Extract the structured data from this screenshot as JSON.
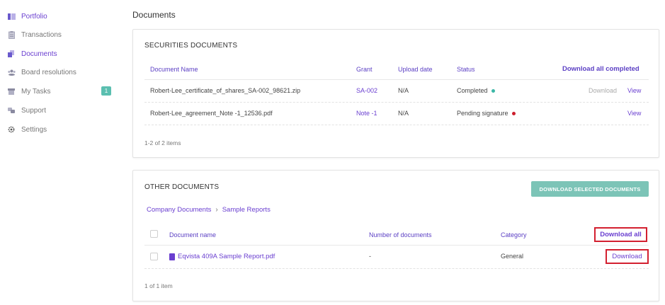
{
  "sidebar": {
    "items": [
      {
        "label": "Portfolio",
        "icon": "portfolio-icon",
        "active": true
      },
      {
        "label": "Transactions",
        "icon": "clipboard-icon",
        "active": false
      },
      {
        "label": "Documents",
        "icon": "documents-icon",
        "active": true
      },
      {
        "label": "Board resolutions",
        "icon": "board-icon",
        "active": false
      },
      {
        "label": "My Tasks",
        "icon": "inbox-icon",
        "active": false,
        "badge": "1"
      },
      {
        "label": "Support",
        "icon": "support-icon",
        "active": false
      },
      {
        "label": "Settings",
        "icon": "gear-icon",
        "active": false
      }
    ]
  },
  "page": {
    "title": "Documents"
  },
  "securities": {
    "title": "SECURITIES DOCUMENTS",
    "columns": {
      "name": "Document Name",
      "grant": "Grant",
      "upload_date": "Upload date",
      "status": "Status",
      "action": "Download all completed"
    },
    "rows": [
      {
        "name": "Robert-Lee_certificate_of_shares_SA-002_98621.zip",
        "grant": "SA-002",
        "upload_date": "N/A",
        "status": "Completed",
        "status_color": "#3cb7a6",
        "download": "Download",
        "view": "View"
      },
      {
        "name": "Robert-Lee_agreement_Note -1_12536.pdf",
        "grant": "Note -1",
        "upload_date": "N/A",
        "status": "Pending signature",
        "status_color": "#cc1e2c",
        "download": "",
        "view": "View"
      }
    ],
    "footer": "1-2 of 2 items"
  },
  "other": {
    "title": "OTHER DOCUMENTS",
    "download_selected": "DOWNLOAD SELECTED DOCUMENTS",
    "breadcrumb": [
      "Company Documents",
      "Sample Reports"
    ],
    "columns": {
      "name": "Document name",
      "count": "Number of documents",
      "category": "Category",
      "action": "Download all"
    },
    "rows": [
      {
        "name": "Eqvista 409A Sample Report.pdf",
        "count": "-",
        "category": "General",
        "action": "Download"
      }
    ],
    "footer": "1 of 1 item"
  },
  "colors": {
    "accent": "#6a3fd0",
    "teal": "#7cc4b7",
    "highlight": "#d32030"
  }
}
